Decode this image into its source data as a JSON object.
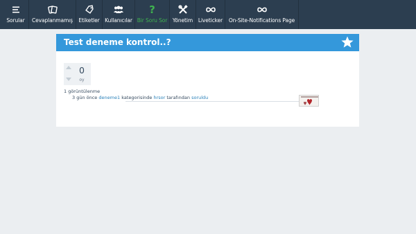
{
  "nav": {
    "items": [
      {
        "label": "Sorular",
        "icon": "list-icon"
      },
      {
        "label": "Cevaplanmamış",
        "icon": "unanswered-cards-icon"
      },
      {
        "label": "Etiketler",
        "icon": "tag-icon"
      },
      {
        "label": "Kullanıcılar",
        "icon": "users-icon"
      },
      {
        "label": "Bir Soru Sor",
        "icon": "question-mark-icon"
      },
      {
        "label": "Yönetim",
        "icon": "tools-icon"
      },
      {
        "label": "Liveticker",
        "icon": "infinity-icon"
      },
      {
        "label": "On-Site-Notifications Page",
        "icon": "infinity-icon"
      }
    ]
  },
  "question": {
    "title": "Test deneme kontrol..?",
    "votes": "0",
    "votes_label": "oy",
    "views": "1 görüntülenme",
    "meta": {
      "time": "3 gün önce",
      "category": "deneme1",
      "category_suffix": "kategorisinde",
      "user": "hrsor",
      "by_text": "tarafından",
      "action": "soruldu"
    }
  },
  "colors": {
    "topbar": "#2c3e50",
    "accent": "#3498db",
    "ask_green": "#3fb34f",
    "link": "#2980b9",
    "background": "#ebeef1"
  }
}
